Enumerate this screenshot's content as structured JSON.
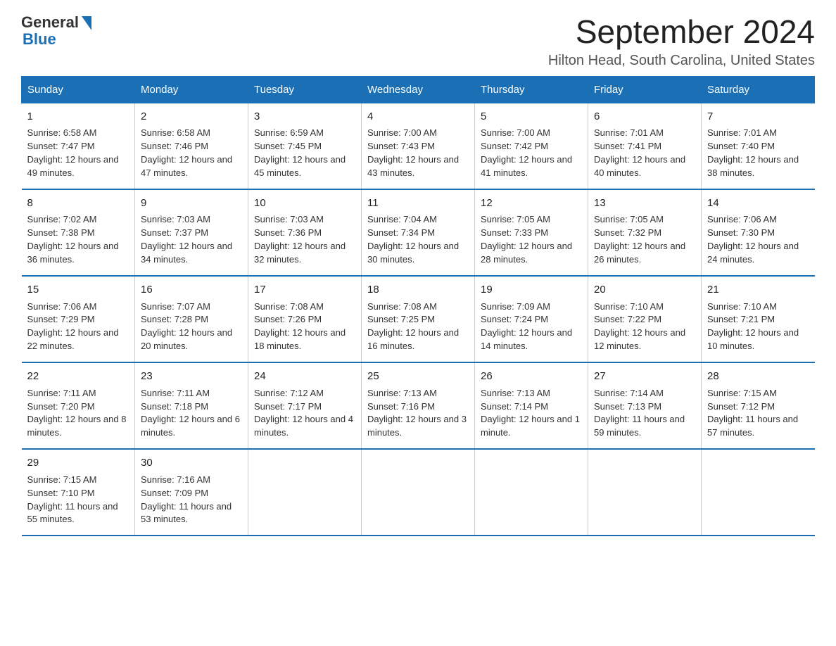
{
  "logo": {
    "general": "General",
    "blue": "Blue"
  },
  "title": "September 2024",
  "location": "Hilton Head, South Carolina, United States",
  "headers": [
    "Sunday",
    "Monday",
    "Tuesday",
    "Wednesday",
    "Thursday",
    "Friday",
    "Saturday"
  ],
  "weeks": [
    [
      {
        "day": "1",
        "sunrise": "6:58 AM",
        "sunset": "7:47 PM",
        "daylight": "12 hours and 49 minutes."
      },
      {
        "day": "2",
        "sunrise": "6:58 AM",
        "sunset": "7:46 PM",
        "daylight": "12 hours and 47 minutes."
      },
      {
        "day": "3",
        "sunrise": "6:59 AM",
        "sunset": "7:45 PM",
        "daylight": "12 hours and 45 minutes."
      },
      {
        "day": "4",
        "sunrise": "7:00 AM",
        "sunset": "7:43 PM",
        "daylight": "12 hours and 43 minutes."
      },
      {
        "day": "5",
        "sunrise": "7:00 AM",
        "sunset": "7:42 PM",
        "daylight": "12 hours and 41 minutes."
      },
      {
        "day": "6",
        "sunrise": "7:01 AM",
        "sunset": "7:41 PM",
        "daylight": "12 hours and 40 minutes."
      },
      {
        "day": "7",
        "sunrise": "7:01 AM",
        "sunset": "7:40 PM",
        "daylight": "12 hours and 38 minutes."
      }
    ],
    [
      {
        "day": "8",
        "sunrise": "7:02 AM",
        "sunset": "7:38 PM",
        "daylight": "12 hours and 36 minutes."
      },
      {
        "day": "9",
        "sunrise": "7:03 AM",
        "sunset": "7:37 PM",
        "daylight": "12 hours and 34 minutes."
      },
      {
        "day": "10",
        "sunrise": "7:03 AM",
        "sunset": "7:36 PM",
        "daylight": "12 hours and 32 minutes."
      },
      {
        "day": "11",
        "sunrise": "7:04 AM",
        "sunset": "7:34 PM",
        "daylight": "12 hours and 30 minutes."
      },
      {
        "day": "12",
        "sunrise": "7:05 AM",
        "sunset": "7:33 PM",
        "daylight": "12 hours and 28 minutes."
      },
      {
        "day": "13",
        "sunrise": "7:05 AM",
        "sunset": "7:32 PM",
        "daylight": "12 hours and 26 minutes."
      },
      {
        "day": "14",
        "sunrise": "7:06 AM",
        "sunset": "7:30 PM",
        "daylight": "12 hours and 24 minutes."
      }
    ],
    [
      {
        "day": "15",
        "sunrise": "7:06 AM",
        "sunset": "7:29 PM",
        "daylight": "12 hours and 22 minutes."
      },
      {
        "day": "16",
        "sunrise": "7:07 AM",
        "sunset": "7:28 PM",
        "daylight": "12 hours and 20 minutes."
      },
      {
        "day": "17",
        "sunrise": "7:08 AM",
        "sunset": "7:26 PM",
        "daylight": "12 hours and 18 minutes."
      },
      {
        "day": "18",
        "sunrise": "7:08 AM",
        "sunset": "7:25 PM",
        "daylight": "12 hours and 16 minutes."
      },
      {
        "day": "19",
        "sunrise": "7:09 AM",
        "sunset": "7:24 PM",
        "daylight": "12 hours and 14 minutes."
      },
      {
        "day": "20",
        "sunrise": "7:10 AM",
        "sunset": "7:22 PM",
        "daylight": "12 hours and 12 minutes."
      },
      {
        "day": "21",
        "sunrise": "7:10 AM",
        "sunset": "7:21 PM",
        "daylight": "12 hours and 10 minutes."
      }
    ],
    [
      {
        "day": "22",
        "sunrise": "7:11 AM",
        "sunset": "7:20 PM",
        "daylight": "12 hours and 8 minutes."
      },
      {
        "day": "23",
        "sunrise": "7:11 AM",
        "sunset": "7:18 PM",
        "daylight": "12 hours and 6 minutes."
      },
      {
        "day": "24",
        "sunrise": "7:12 AM",
        "sunset": "7:17 PM",
        "daylight": "12 hours and 4 minutes."
      },
      {
        "day": "25",
        "sunrise": "7:13 AM",
        "sunset": "7:16 PM",
        "daylight": "12 hours and 3 minutes."
      },
      {
        "day": "26",
        "sunrise": "7:13 AM",
        "sunset": "7:14 PM",
        "daylight": "12 hours and 1 minute."
      },
      {
        "day": "27",
        "sunrise": "7:14 AM",
        "sunset": "7:13 PM",
        "daylight": "11 hours and 59 minutes."
      },
      {
        "day": "28",
        "sunrise": "7:15 AM",
        "sunset": "7:12 PM",
        "daylight": "11 hours and 57 minutes."
      }
    ],
    [
      {
        "day": "29",
        "sunrise": "7:15 AM",
        "sunset": "7:10 PM",
        "daylight": "11 hours and 55 minutes."
      },
      {
        "day": "30",
        "sunrise": "7:16 AM",
        "sunset": "7:09 PM",
        "daylight": "11 hours and 53 minutes."
      },
      null,
      null,
      null,
      null,
      null
    ]
  ]
}
